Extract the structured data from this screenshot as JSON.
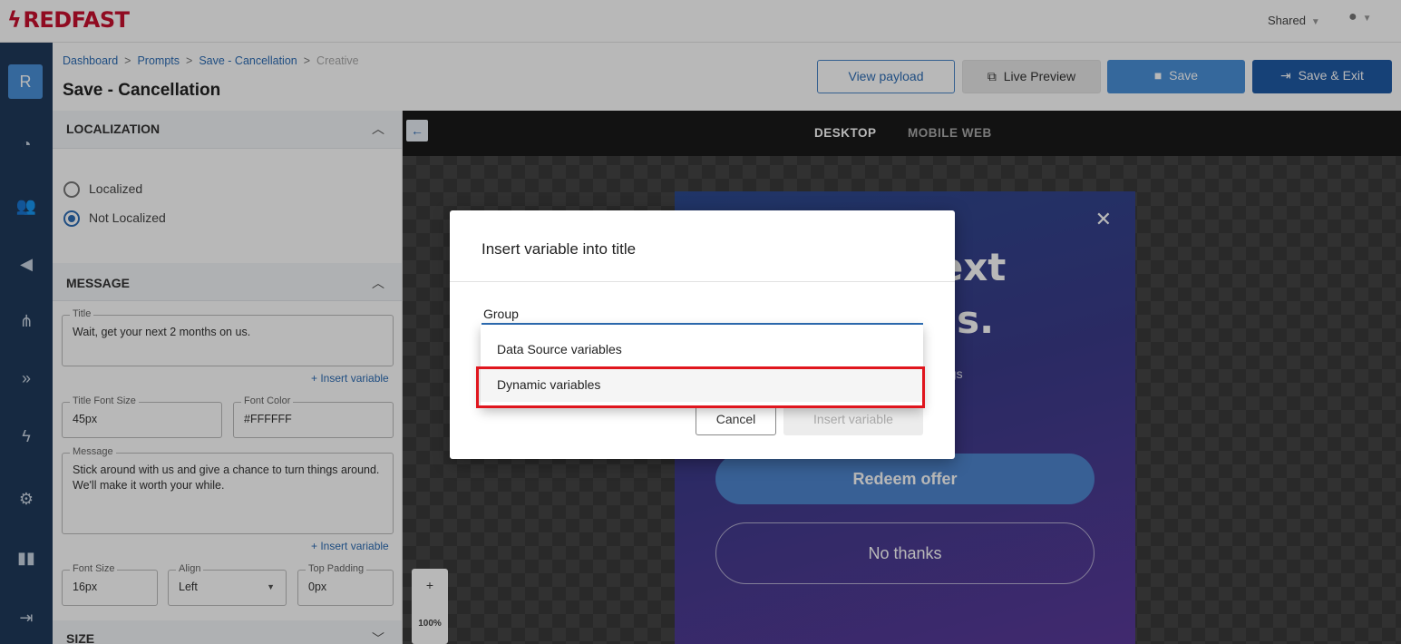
{
  "brand": {
    "name": "REDFAST",
    "color": "#c8102e"
  },
  "topbar": {
    "shared_label": "Shared",
    "user_icon": "user-icon"
  },
  "leftnav": {
    "badge": "R",
    "icons": [
      "dashboard-icon",
      "users-icon",
      "megaphone-icon",
      "flow-icon",
      "chevrons-icon",
      "bolt-icon",
      "gear-icon",
      "book-icon",
      "logout-icon"
    ]
  },
  "breadcrumb": {
    "items": [
      "Dashboard",
      "Prompts",
      "Save - Cancellation"
    ],
    "current": "Creative"
  },
  "page": {
    "title": "Save - Cancellation"
  },
  "toolbar": {
    "view_payload": "View payload",
    "live_preview": "Live Preview",
    "save": "Save",
    "save_exit": "Save & Exit"
  },
  "localization": {
    "heading": "LOCALIZATION",
    "options": [
      "Localized",
      "Not Localized"
    ],
    "selected": "Not Localized"
  },
  "message": {
    "heading": "MESSAGE",
    "title_label": "Title",
    "title_value": "Wait, get your next 2 months on us.",
    "insert_variable": "+ Insert variable",
    "title_font_size_label": "Title Font Size",
    "title_font_size": "45px",
    "font_color_label": "Font Color",
    "font_color": "#FFFFFF",
    "message_label": "Message",
    "message_value": "Stick around with us and give a chance to turn things around. We'll make it worth your while.",
    "font_size_label": "Font Size",
    "font_size": "16px",
    "align_label": "Align",
    "align": "Left",
    "top_padding_label": "Top Padding",
    "top_padding": "0px"
  },
  "size_section": {
    "heading": "SIZE"
  },
  "canvas": {
    "tabs": [
      "DESKTOP",
      "MOBILE WEB"
    ],
    "active_tab": "DESKTOP",
    "zoom_plus": "+",
    "zoom": "100%"
  },
  "preview": {
    "title_visible": "ur next\non us.",
    "message_visible": "ance to turn things\nyour while.",
    "redeem": "Redeem offer",
    "no_thanks": "No thanks",
    "close": "✕"
  },
  "modal": {
    "title": "Insert variable into title",
    "group_label": "Group",
    "options": [
      "Data Source variables",
      "Dynamic variables"
    ],
    "highlighted": "Dynamic variables",
    "cancel": "Cancel",
    "insert": "Insert variable"
  }
}
